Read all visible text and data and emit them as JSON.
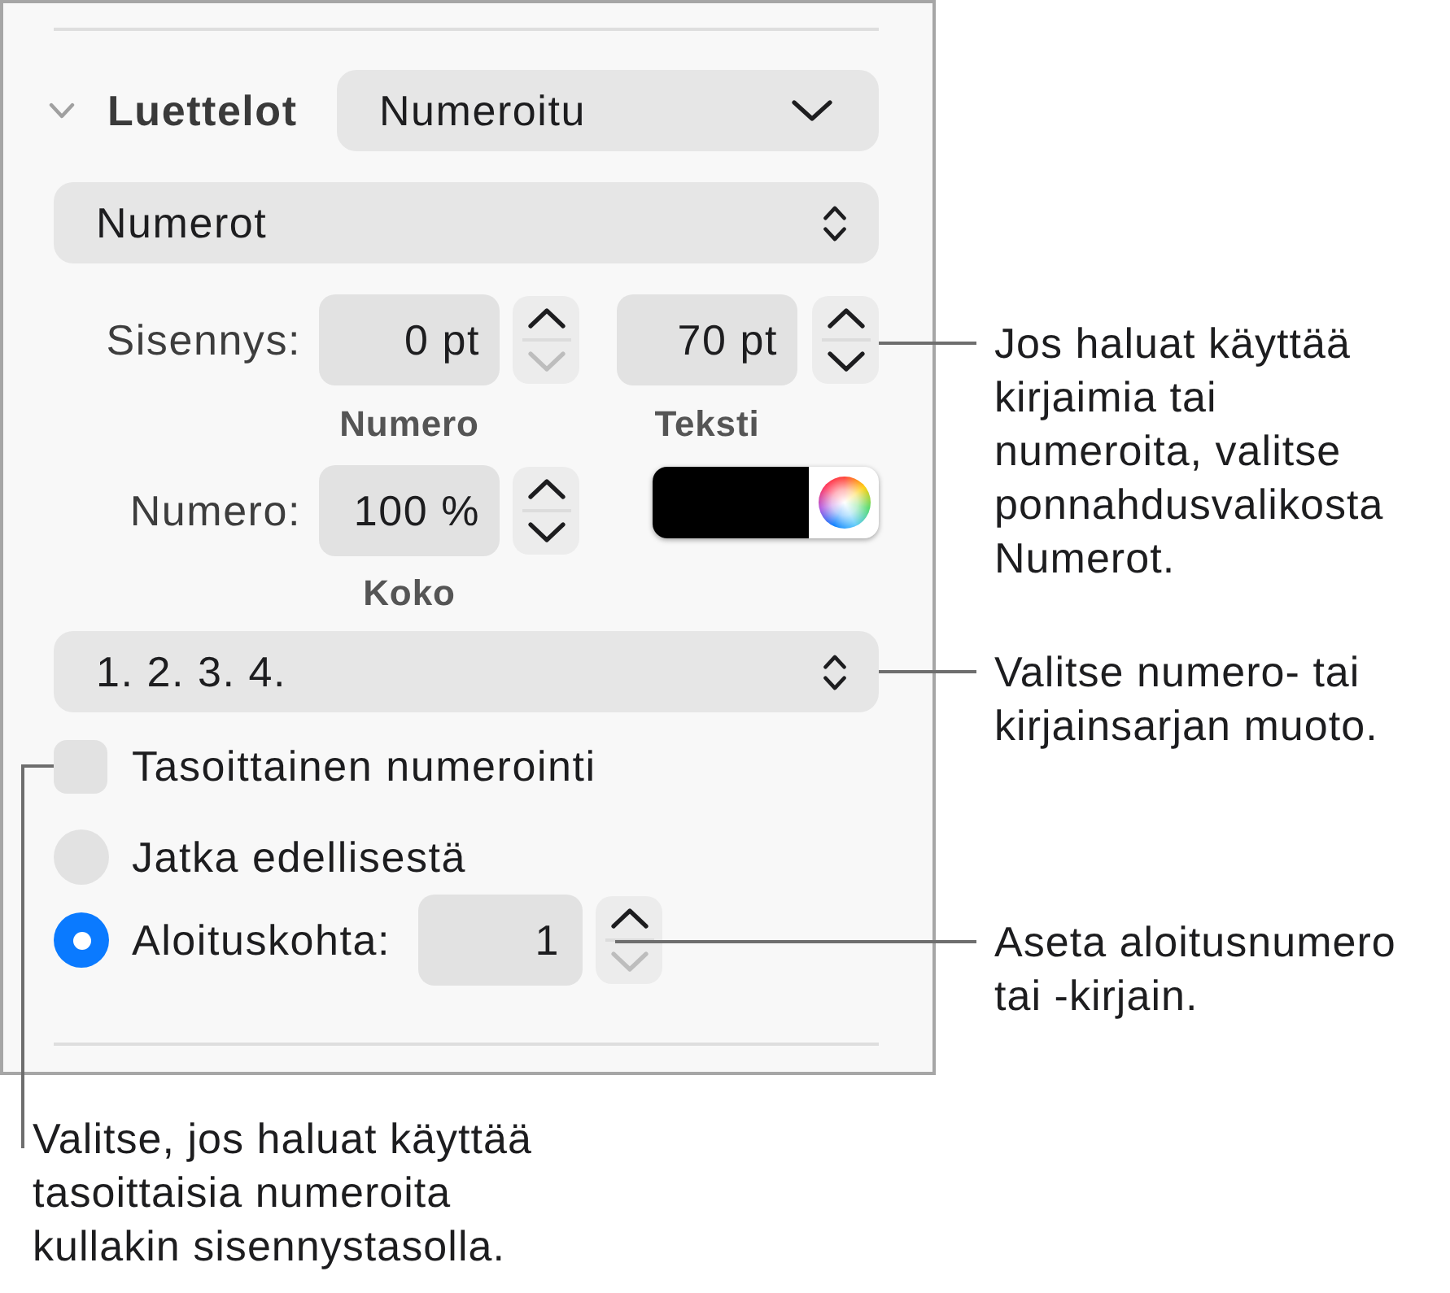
{
  "lists": {
    "title": "Luettelot",
    "expanded": true,
    "list_style": {
      "value": "Numeroitu"
    },
    "bullet_type": {
      "value": "Numerot"
    },
    "indent": {
      "label": "Sisennys:",
      "fields": [
        {
          "value": "0 pt",
          "caption": "Numero",
          "up_disabled": false,
          "down_disabled": true
        },
        {
          "value": "70 pt",
          "caption": "Teksti",
          "up_disabled": false,
          "down_disabled": false
        }
      ]
    },
    "number_size": {
      "label": "Numero:",
      "value": "100 %",
      "caption": "Koko",
      "up_disabled": false,
      "down_disabled": false
    },
    "number_color": {
      "color": "#000000"
    },
    "number_format": {
      "value": "1. 2. 3. 4."
    },
    "tiered_numbering": {
      "label": "Tasoittainen numerointi",
      "checked": false
    },
    "start_options": [
      {
        "label": "Jatka edellisestä",
        "selected": false
      },
      {
        "label": "Aloituskohta:",
        "selected": true,
        "field": {
          "value": "1",
          "up_disabled": false,
          "down_disabled": true
        }
      }
    ]
  },
  "callouts": [
    {
      "text": "Jos haluat käyttää kirjaimia tai numeroita, valitse ponnahdusvalikosta Numerot."
    },
    {
      "text": "Valitse numero- tai kirjainsarjan muoto."
    },
    {
      "text": "Aseta aloitusnumero tai -kirjain."
    },
    {
      "text": "Valitse, jos haluat käyttää tasoittaisia numeroita kullakin sisennystasolla."
    }
  ]
}
